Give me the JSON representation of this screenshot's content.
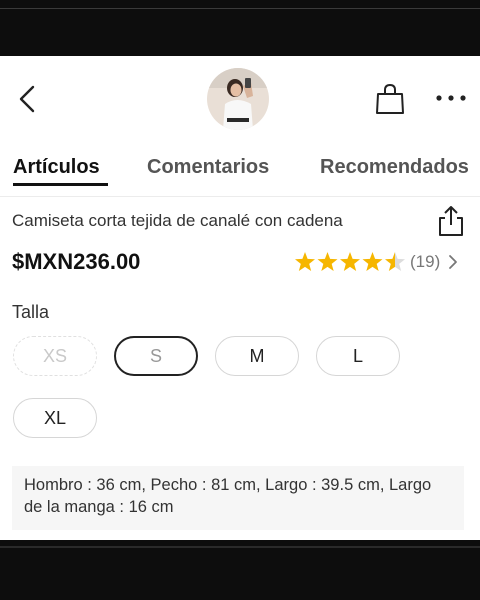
{
  "tabs": [
    {
      "label": "Artículos"
    },
    {
      "label": "Comentarios"
    },
    {
      "label": "Recomendados"
    }
  ],
  "product": {
    "title": "Camiseta corta tejida de canalé con cadena",
    "price": "$MXN236.00",
    "rating": 4.5,
    "review_count": "(19)"
  },
  "size": {
    "label": "Talla",
    "options": [
      {
        "label": "XS",
        "state": "unavailable"
      },
      {
        "label": "S",
        "state": "selected"
      },
      {
        "label": "M",
        "state": "available"
      },
      {
        "label": "L",
        "state": "available"
      },
      {
        "label": "XL",
        "state": "available"
      }
    ]
  },
  "measurements": "Hombro : 36 cm,  Pecho : 81 cm,  Largo : 39.5 cm,  Largo de la manga : 16 cm",
  "colors": {
    "star": "#f6b600",
    "text": "#222222",
    "background": "#ffffff"
  },
  "icons": [
    "chevron-left-icon",
    "shopping-bag-icon",
    "more-icon",
    "share-icon",
    "star-icon",
    "chevron-right-icon"
  ]
}
